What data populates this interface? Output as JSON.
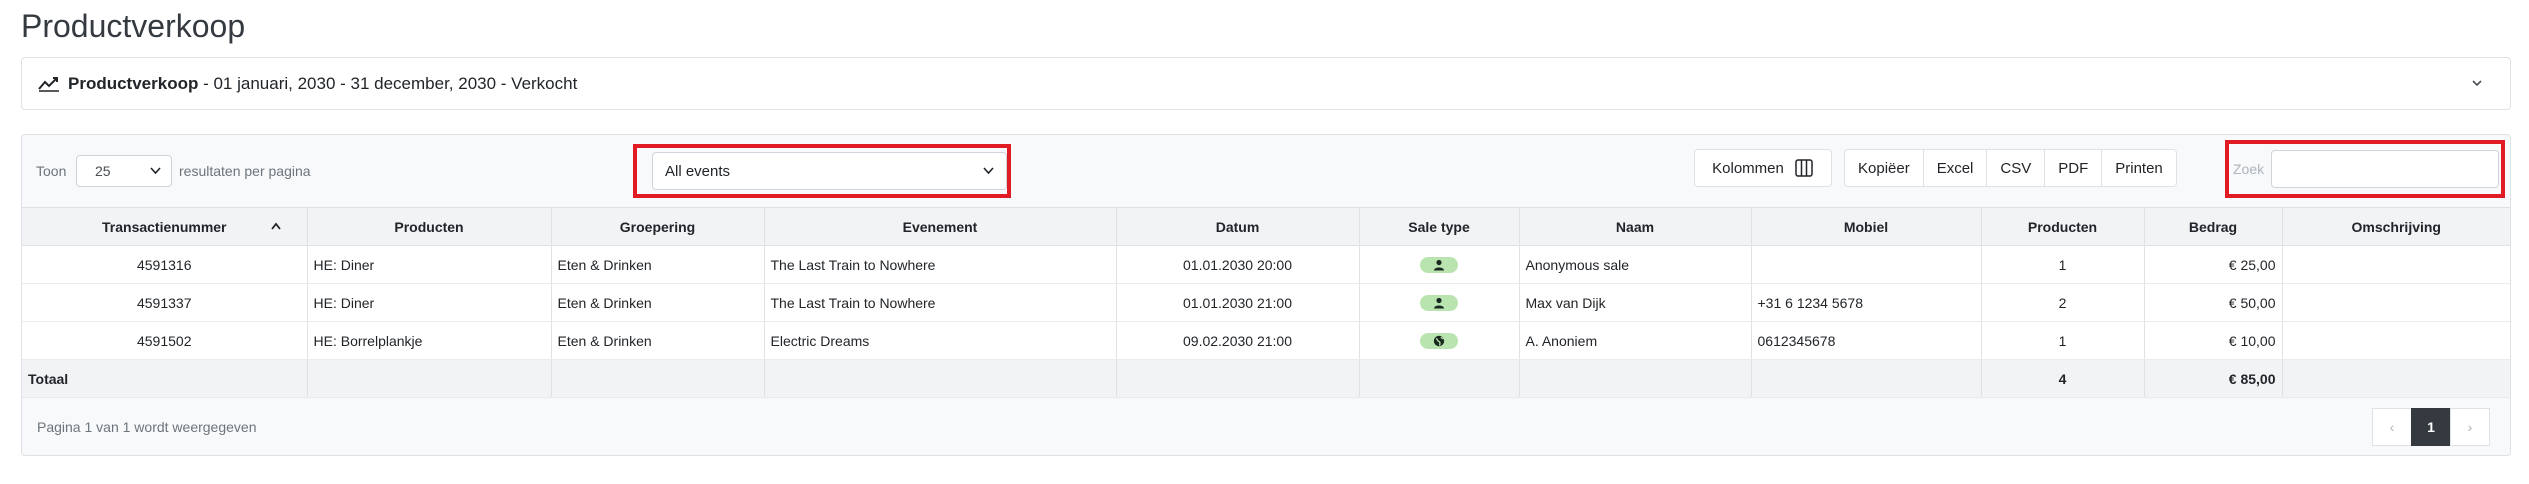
{
  "page": {
    "title": "Productverkoop"
  },
  "report_bar": {
    "label_bold": "Productverkoop",
    "label_rest": " - 01 januari, 2030 - 31 december, 2030 - Verkocht"
  },
  "toolbar": {
    "show_label": "Toon",
    "page_length": "25",
    "per_page_label": "resultaten per pagina",
    "event_filter": "All events",
    "columns_button": "Kolommen",
    "export_buttons": [
      "Kopiëer",
      "Excel",
      "CSV",
      "PDF",
      "Printen"
    ],
    "search_label": "Zoek",
    "search_value": ""
  },
  "table": {
    "columns": [
      "Transactienummer",
      "Producten",
      "Groepering",
      "Evenement",
      "Datum",
      "Sale type",
      "Naam",
      "Mobiel",
      "Producten",
      "Bedrag",
      "Omschrijving"
    ],
    "rows": [
      {
        "id": "4591316",
        "product": "HE: Diner",
        "group": "Eten & Drinken",
        "event": "The Last Train to Nowhere",
        "date": "01.01.2030 20:00",
        "sale_type": "person-icon",
        "name": "Anonymous sale",
        "mobile": "",
        "qty": "1",
        "amount": "€ 25,00",
        "desc": ""
      },
      {
        "id": "4591337",
        "product": "HE: Diner",
        "group": "Eten & Drinken",
        "event": "The Last Train to Nowhere",
        "date": "01.01.2030 21:00",
        "sale_type": "person-icon",
        "name": "Max van Dijk",
        "mobile": "+31 6 1234 5678",
        "qty": "2",
        "amount": "€ 50,00",
        "desc": ""
      },
      {
        "id": "4591502",
        "product": "HE: Borrelplankje",
        "group": "Eten & Drinken",
        "event": "Electric Dreams",
        "date": "09.02.2030 21:00",
        "sale_type": "globe-icon",
        "name": "A. Anoniem",
        "mobile": "0612345678",
        "qty": "1",
        "amount": "€ 10,00",
        "desc": ""
      }
    ],
    "total": {
      "label": "Totaal",
      "qty": "4",
      "amount": "€ 85,00"
    }
  },
  "footer": {
    "info": "Pagina 1 van 1 wordt weergegeven",
    "pages": [
      "‹",
      "1",
      "›"
    ]
  },
  "colors": {
    "highlight": "#e01b24",
    "badge": "#b9e4b0",
    "active_page": "#343a40"
  }
}
